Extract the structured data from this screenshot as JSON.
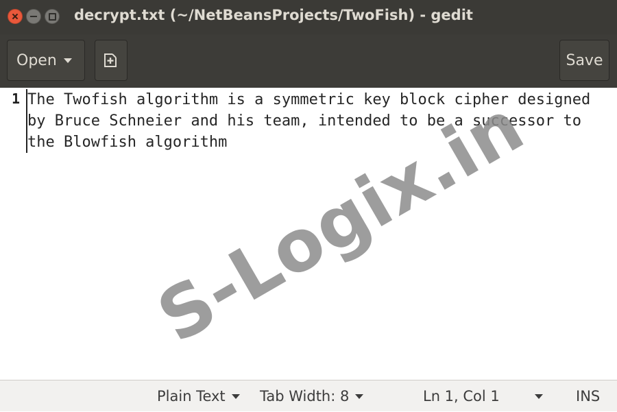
{
  "window": {
    "title": "decrypt.txt (~/NetBeansProjects/TwoFish) - gedit",
    "controls": [
      "close-icon",
      "minimize-icon",
      "maximize-icon"
    ]
  },
  "toolbar": {
    "open_label": "Open",
    "new_document_icon": "new-document-icon",
    "save_label": "Save"
  },
  "editor": {
    "line_number": "1",
    "text": "The Twofish algorithm is a symmetric key block cipher designed\nby Bruce Schneier and his team, intended to be a successor to\nthe Blowfish algorithm"
  },
  "watermark": "S-Logix.in",
  "statusbar": {
    "language": "Plain Text",
    "tab_width": "Tab Width: 8",
    "position": "Ln 1, Col 1",
    "mode": "INS"
  }
}
